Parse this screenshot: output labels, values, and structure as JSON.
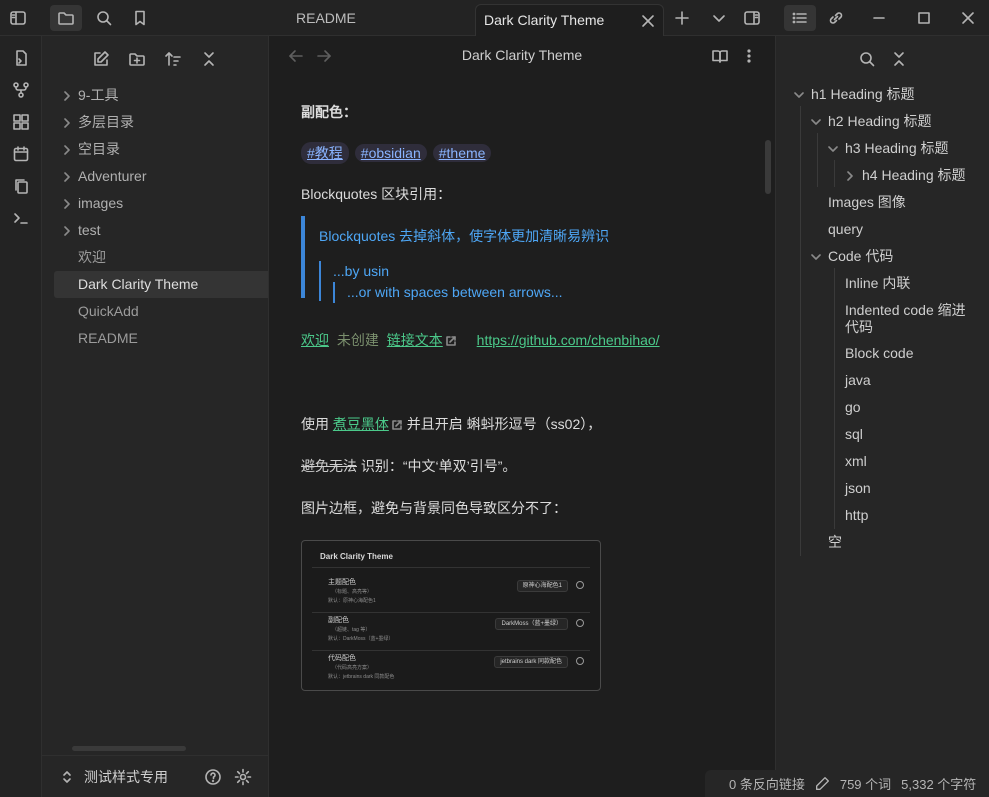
{
  "tabs": {
    "readme": "README",
    "active": "Dark Clarity Theme"
  },
  "view_title": "Dark Clarity Theme",
  "explorer": {
    "items": [
      {
        "label": "9-工具",
        "type": "folder"
      },
      {
        "label": "多层目录",
        "type": "folder"
      },
      {
        "label": "空目录",
        "type": "folder"
      },
      {
        "label": "Adventurer",
        "type": "folder"
      },
      {
        "label": "images",
        "type": "folder"
      },
      {
        "label": "test",
        "type": "folder"
      },
      {
        "label": "欢迎",
        "type": "file"
      },
      {
        "label": "Dark Clarity Theme",
        "type": "file",
        "active": true
      },
      {
        "label": "QuickAdd",
        "type": "file"
      },
      {
        "label": "README",
        "type": "file"
      }
    ],
    "vault_name": "测试样式专用"
  },
  "content": {
    "secondary_color_heading": "副配色：",
    "tags": [
      "#教程",
      "#obsidian",
      "#theme"
    ],
    "blockquotes_heading": "Blockquotes 区块引用：",
    "bq_line1": "Blockquotes 去掉斜体，使字体更加清晰易辨识",
    "bq_line2": "...by usin",
    "bq_line3": "...or with spaces between arrows...",
    "link_welcome": "欢迎",
    "link_uncreated": "未创建",
    "link_text": "链接文本",
    "link_url": "https://github.com/chenbihao/",
    "use_prefix": "使用",
    "font_link": "煮豆黑体",
    "use_suffix": "并且开启 蝌蚪形逗号（ss02），",
    "strike_text": "避免无法",
    "recognize_text": " 识别：“中文‘单双’引号”。",
    "image_border_text": "图片边框，避免与背景同色导致区分不了：",
    "image": {
      "title": "Dark Clarity Theme",
      "rows": [
        {
          "name": "主题配色",
          "sub": "（标题、高亮等）",
          "desc": "默认：原神心海配色1",
          "value": "原神心海配色1"
        },
        {
          "name": "副配色",
          "sub": "（超链、tag 等）",
          "desc": "默认：DarkMoss（蓝+墨绿）",
          "value": "DarkMoss（蓝+墨绿）"
        },
        {
          "name": "代码配色",
          "sub": "（代码高亮方案）",
          "desc": "默认：jetbrains dark 同款配色",
          "value": "jetbrains dark 同款配色"
        }
      ]
    }
  },
  "outline": {
    "items": [
      {
        "label": "h1 Heading 标题",
        "level": 0,
        "chev": "down"
      },
      {
        "label": "h2 Heading 标题",
        "level": 1,
        "chev": "down"
      },
      {
        "label": "h3 Heading 标题",
        "level": 2,
        "chev": "down"
      },
      {
        "label": "h4 Heading 标题",
        "level": 3,
        "chev": "right"
      },
      {
        "label": "Images 图像",
        "level": 1,
        "chev": ""
      },
      {
        "label": "query",
        "level": 1,
        "chev": ""
      },
      {
        "label": "Code 代码",
        "level": 1,
        "chev": "down"
      },
      {
        "label": "Inline 内联",
        "level": 2,
        "chev": ""
      },
      {
        "label": "Indented code 缩进代码",
        "level": 2,
        "chev": ""
      },
      {
        "label": "Block code",
        "level": 2,
        "chev": ""
      },
      {
        "label": "java",
        "level": 2,
        "chev": ""
      },
      {
        "label": "go",
        "level": 2,
        "chev": ""
      },
      {
        "label": "sql",
        "level": 2,
        "chev": ""
      },
      {
        "label": "xml",
        "level": 2,
        "chev": ""
      },
      {
        "label": "json",
        "level": 2,
        "chev": ""
      },
      {
        "label": "http",
        "level": 2,
        "chev": ""
      },
      {
        "label": "空",
        "level": 1,
        "chev": ""
      }
    ]
  },
  "status": {
    "backlinks": "0 条反向链接",
    "words": "759 个词",
    "chars": "5,332 个字符"
  }
}
